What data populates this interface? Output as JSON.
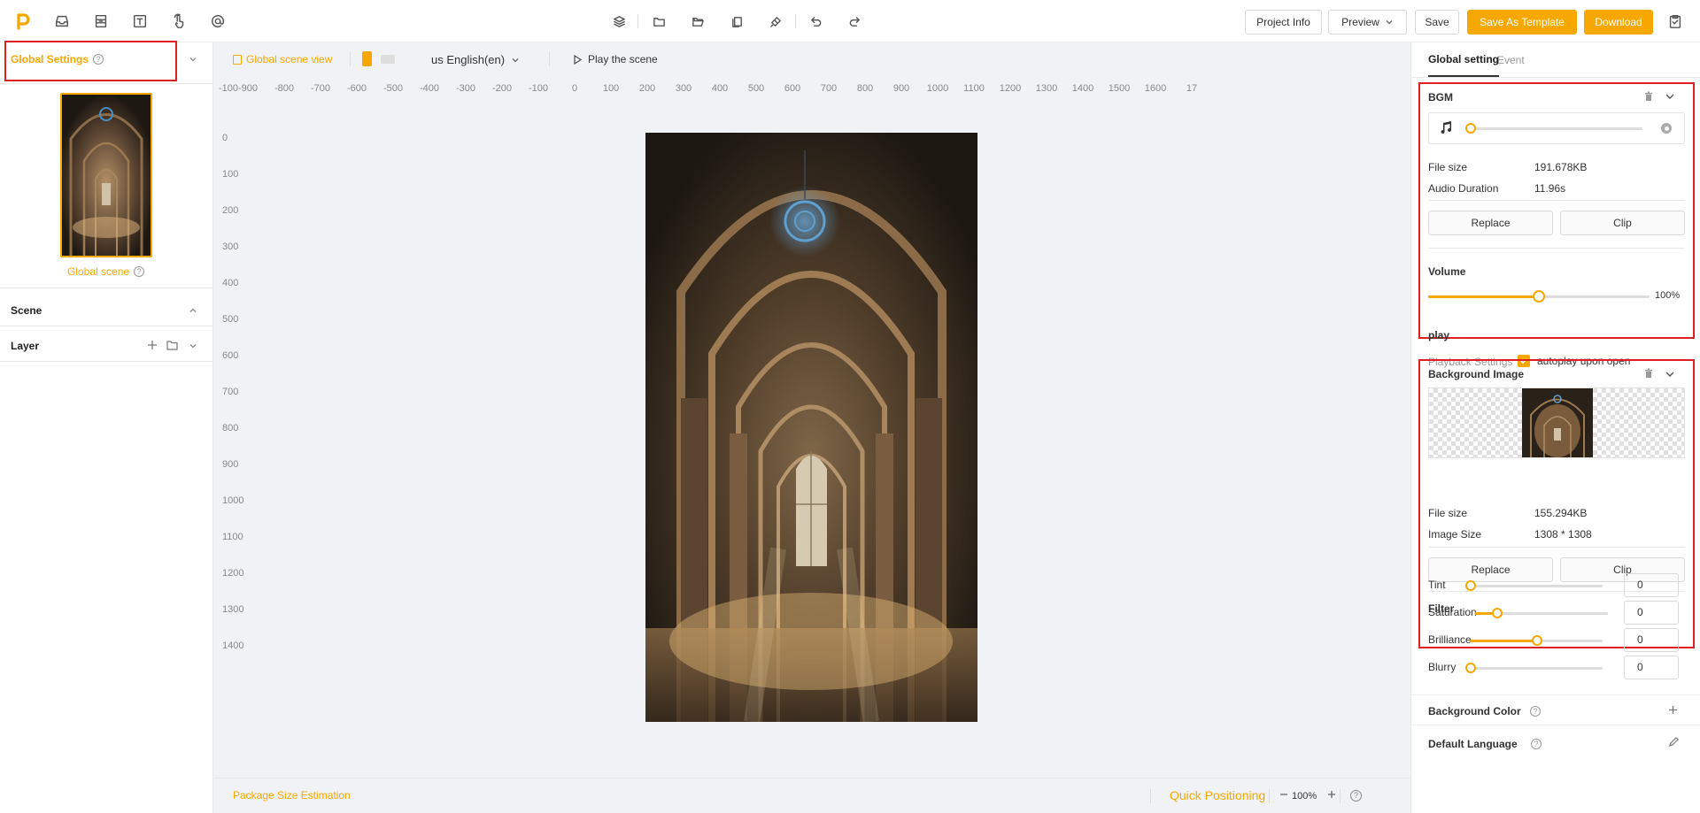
{
  "toolbar": {
    "left_icons": [
      "logo-icon",
      "inbox-icon",
      "form-icon",
      "text-icon",
      "touch-icon",
      "at-icon"
    ],
    "mid_icons": [
      "layers-icon",
      "folder-icon",
      "folder-open-icon",
      "copy-icon",
      "paint-icon",
      "undo-icon",
      "redo-icon"
    ],
    "project_info": "Project Info",
    "preview": "Preview",
    "save": "Save",
    "save_as_template": "Save As Template",
    "download": "Download",
    "accent": "#f7a800"
  },
  "left": {
    "global_settings": "Global Settings",
    "global_scene": "Global scene",
    "scene": "Scene",
    "layer": "Layer"
  },
  "canvas": {
    "global_scene_view": "Global scene view",
    "language": "us English(en)",
    "play_scene": "Play the scene",
    "ruler_x": [
      "-100",
      "-900",
      "-800",
      "-700",
      "-600",
      "-500",
      "-400",
      "-300",
      "-200",
      "-100",
      "0",
      "100",
      "200",
      "300",
      "400",
      "500",
      "600",
      "700",
      "800",
      "900",
      "1000",
      "1100",
      "1200",
      "1300",
      "1400",
      "1500",
      "1600",
      "17"
    ],
    "ruler_y": [
      "0",
      "100",
      "200",
      "300",
      "400",
      "500",
      "600",
      "700",
      "800",
      "900",
      "1000",
      "1100",
      "1200",
      "1300",
      "1400"
    ],
    "package_size": "Package Size Estimation",
    "quick_positioning": "Quick Positioning",
    "zoom": "100%"
  },
  "right": {
    "tabs": [
      "Global setting",
      "Event"
    ],
    "bgm": {
      "title": "BGM",
      "file_size_label": "File size",
      "file_size": "191.678KB",
      "duration_label": "Audio Duration",
      "duration": "11.96s",
      "replace": "Replace",
      "clip": "Clip",
      "volume_label": "Volume",
      "volume": "100%",
      "volume_fraction": 0.5,
      "play_label": "play",
      "playback_settings": "Playback Settings",
      "autoplay": "autoplay upon open"
    },
    "background_image": {
      "title": "Background Image",
      "file_size_label": "File size",
      "file_size": "155.294KB",
      "image_size_label": "Image Size",
      "image_size": "1308 * 1308",
      "replace": "Replace",
      "clip": "Clip",
      "filter_label": "Filter",
      "filters": [
        {
          "name": "Tint",
          "value": "0",
          "fraction": 0.0
        },
        {
          "name": "Saturation",
          "value": "0",
          "fraction": 0.16
        },
        {
          "name": "Brilliance",
          "value": "0",
          "fraction": 0.5
        },
        {
          "name": "Blurry",
          "value": "0",
          "fraction": 0.0
        }
      ]
    },
    "background_color": "Background Color",
    "default_language": "Default Language"
  }
}
